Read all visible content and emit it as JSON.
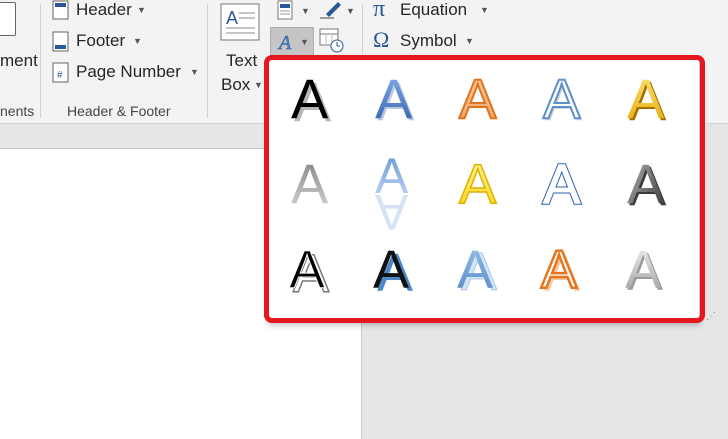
{
  "ribbon": {
    "cut_label_left": "ment",
    "cut_group_left": "nents",
    "header_label": "Header",
    "footer_label": "Footer",
    "page_number_label": "Page Number",
    "group_label": "Header & Footer",
    "textbox_line1": "Text",
    "textbox_line2": "Box",
    "equation_label": "Equation",
    "symbol_label": "Symbol",
    "pi_glyph": "π",
    "omega_glyph": "Ω"
  },
  "wordart": {
    "glyph": "A",
    "styles": [
      [
        "black-shadow",
        "blue-gradient",
        "orange-outline",
        "light-blue-outline",
        "gold-bevel"
      ],
      [
        "gray-gradient",
        "blue-reflection",
        "yellow-outline",
        "blue-double-outline",
        "gray-bevel"
      ],
      [
        "black-hard-shadow",
        "black-blue-shadow",
        "blue-layered",
        "orange-white-outline",
        "silver-gradient"
      ]
    ]
  },
  "colors": {
    "highlight": "#e4161e",
    "ribbon_bg": "#f3f3f3",
    "accent_blue": "#2b579a"
  }
}
